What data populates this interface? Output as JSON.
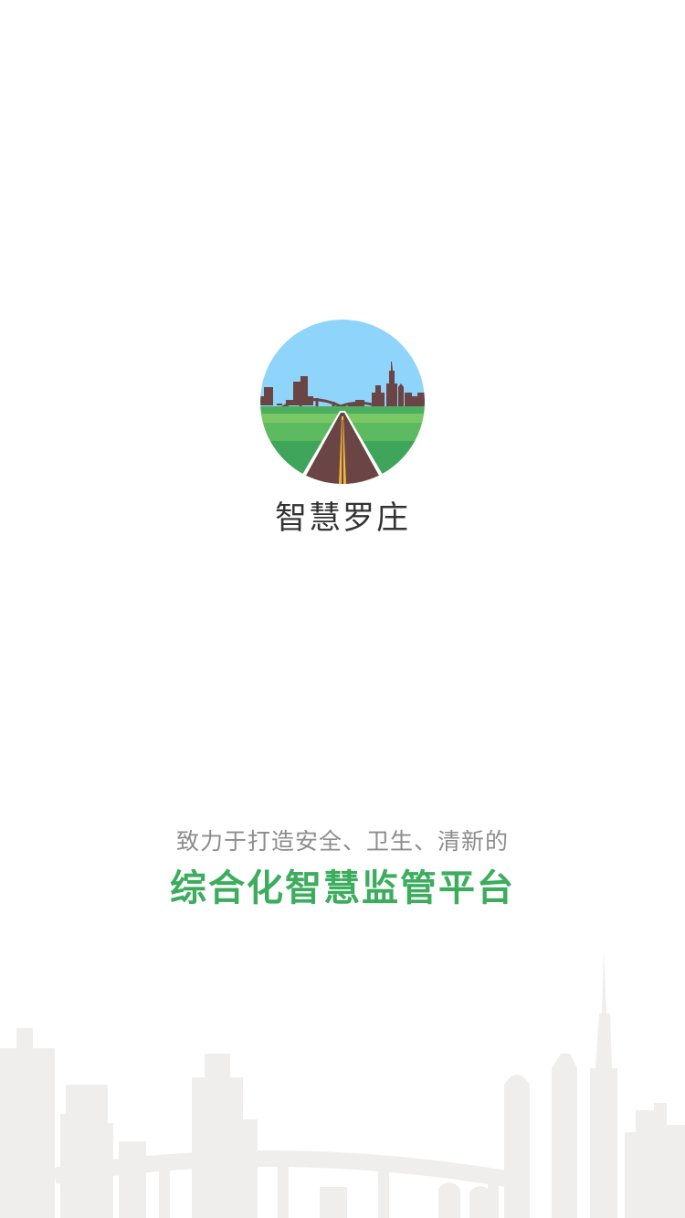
{
  "splash": {
    "app_name": "智慧罗庄",
    "tagline": "致力于打造安全、卫生、清新的",
    "slogan": "综合化智慧监管平台",
    "logo_icon": "city-road-logo-icon",
    "skyline_icon": "city-skyline-icon"
  },
  "colors": {
    "background": "#ffffff",
    "app_name": "#333333",
    "tagline": "#8c8c8c",
    "slogan": "#3bad5c",
    "sky": "#8fd4fb",
    "city": "#6b4445",
    "grass": "#4cae5f",
    "road": "#6b4445",
    "road_line": "#f1b63a",
    "skyline": "#f0eeed"
  }
}
